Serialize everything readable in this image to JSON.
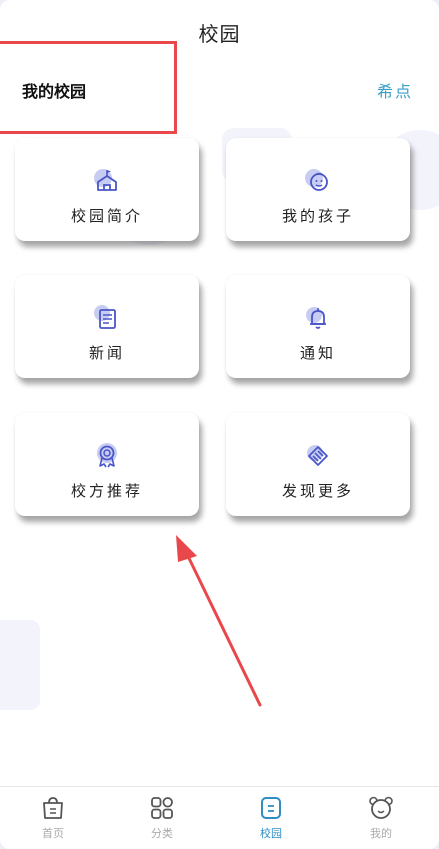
{
  "header": {
    "title": "校园"
  },
  "section": {
    "title": "我的校园",
    "link": "希点"
  },
  "cards": [
    {
      "label": "校园简介",
      "icon": "school-icon"
    },
    {
      "label": "我的孩子",
      "icon": "child-face-icon"
    },
    {
      "label": "新闻",
      "icon": "newspaper-icon"
    },
    {
      "label": "通知",
      "icon": "bell-icon"
    },
    {
      "label": "校方推荐",
      "icon": "award-badge-icon"
    },
    {
      "label": "发现更多",
      "icon": "diamond-layers-icon"
    }
  ],
  "tabbar": [
    {
      "label": "首页",
      "icon": "home-bag-icon",
      "active": false
    },
    {
      "label": "分类",
      "icon": "grid-category-icon",
      "active": false
    },
    {
      "label": "校园",
      "icon": "campus-square-icon",
      "active": true
    },
    {
      "label": "我的",
      "icon": "bear-face-icon",
      "active": false
    }
  ],
  "colors": {
    "accent": "#2d8ec4",
    "annotation": "#e8484b",
    "icon_blue": "#4a56c8",
    "icon_bubble": "#c7ccf2"
  }
}
